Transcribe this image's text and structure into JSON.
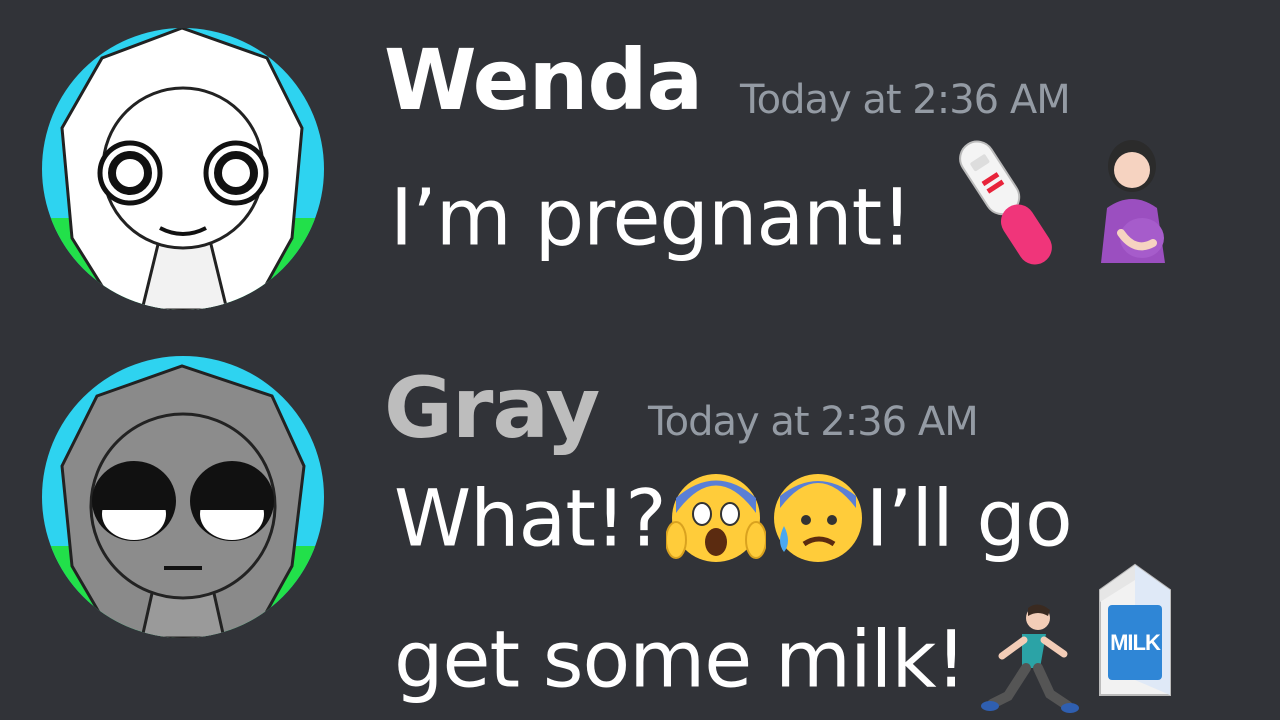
{
  "messages": [
    {
      "author": "Wenda",
      "author_color": "#ffffff",
      "timestamp": "Today at 2:36 AM",
      "text": "I’m pregnant!",
      "emojis": [
        "pregnancy-test-emoji",
        "pregnant-woman-emoji"
      ]
    },
    {
      "author": "Gray",
      "author_color": "#bdbdbd",
      "timestamp": "Today at 2:36 AM",
      "text_line1_a": "What!?",
      "text_line1_b": "I’ll go",
      "text_line2": "get some milk!",
      "emojis": [
        "face-screaming-in-fear-emoji",
        "anxious-face-with-sweat-emoji",
        "man-running-emoji",
        "milk-carton-emoji"
      ],
      "milk_carton_label": "MILK"
    }
  ],
  "colors": {
    "background": "#313338",
    "timestamp": "#949ba4",
    "message_text": "#ffffff"
  }
}
